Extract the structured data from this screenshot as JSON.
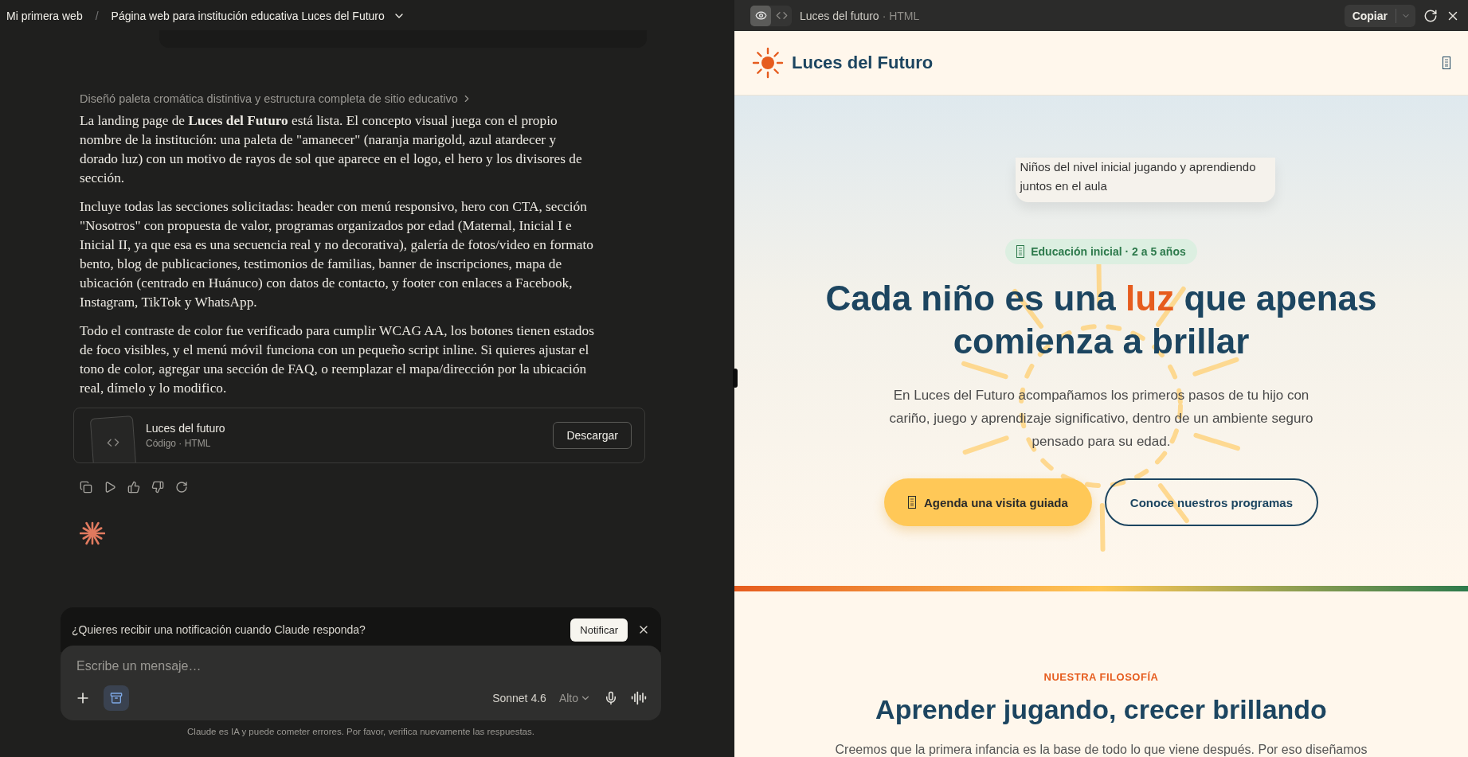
{
  "chat": {
    "breadcrumb": {
      "project": "Mi primera web",
      "separator": "/",
      "title": "Página web para institución educativa Luces del Futuro"
    },
    "thinking_summary": "Diseñó paleta cromática distintiva y estructura completa de sitio educativo",
    "paragraphs": [
      "La landing page de **Luces del Futuro** está lista. El concepto visual juega con el propio nombre de la institución: una paleta de \"amanecer\" (naranja marigold, azul atardecer y dorado luz) con un motivo de rayos de sol que aparece en el logo, el hero y los divisores de sección.",
      "Incluye todas las secciones solicitadas: header con menú responsivo, hero con CTA, sección \"Nosotros\" con propuesta de valor, programas organizados por edad (Maternal, Inicial I e Inicial II, ya que esa es una secuencia real y no decorativa), galería de fotos/video en formato bento, blog de publicaciones, testimonios de familias, banner de inscripciones, mapa de ubicación (centrado en Huánuco) con datos de contacto, y footer con enlaces a Facebook, Instagram, TikTok y WhatsApp.",
      "Todo el contraste de color fue verificado para cumplir WCAG AA, los botones tienen estados de foco visibles, y el menú móvil funciona con un pequeño script inline. Si quieres ajustar el tono de color, agregar una sección de FAQ, o reemplazar el mapa/dirección por la ubicación real, dímelo y lo modifico."
    ],
    "artifact": {
      "name": "Luces del futuro",
      "meta": "Código · HTML",
      "button": "Descargar"
    },
    "notification": {
      "text": "¿Quieres recibir una notificación cuando Claude responda?",
      "button": "Notificar"
    },
    "composer": {
      "placeholder": "Escribe un mensaje…",
      "model": "Sonnet 4.6",
      "effort": "Alto"
    },
    "disclaimer": "Claude es IA y puede cometer errores. Por favor, verifica nuevamente las respuestas."
  },
  "preview": {
    "view_toggle": [
      {
        "kind": "preview",
        "selected": true
      },
      {
        "kind": "code",
        "selected": false
      }
    ],
    "title": "Luces del futuro",
    "meta": "· HTML",
    "copy_button": "Copiar",
    "site": {
      "logo": "Luces del Futuro",
      "hero": {
        "caption": "Niños del nivel inicial jugando y aprendiendo juntos en el aula",
        "badge": "Educación inicial · 2 a 5 años",
        "headline": "Cada niño es una **luz** que apenas comienza a brillar",
        "text": "En Luces del Futuro acompañamos los primeros pasos de tu hijo con cariño, juego y aprendizaje significativo, dentro de un ambiente seguro pensado para su edad.",
        "buttons": [
          {
            "kind": "primary",
            "label": "Agenda una visita guiada"
          },
          {
            "kind": "secondary",
            "label": "Conoce nuestros programas"
          }
        ]
      },
      "section": {
        "eyebrow": "NUESTRA FILOSOFÍA",
        "heading": "Aprender jugando, crecer brillando",
        "text": "Creemos que la primera infancia es la base de todo lo que viene después. Por eso diseñamos"
      }
    }
  }
}
